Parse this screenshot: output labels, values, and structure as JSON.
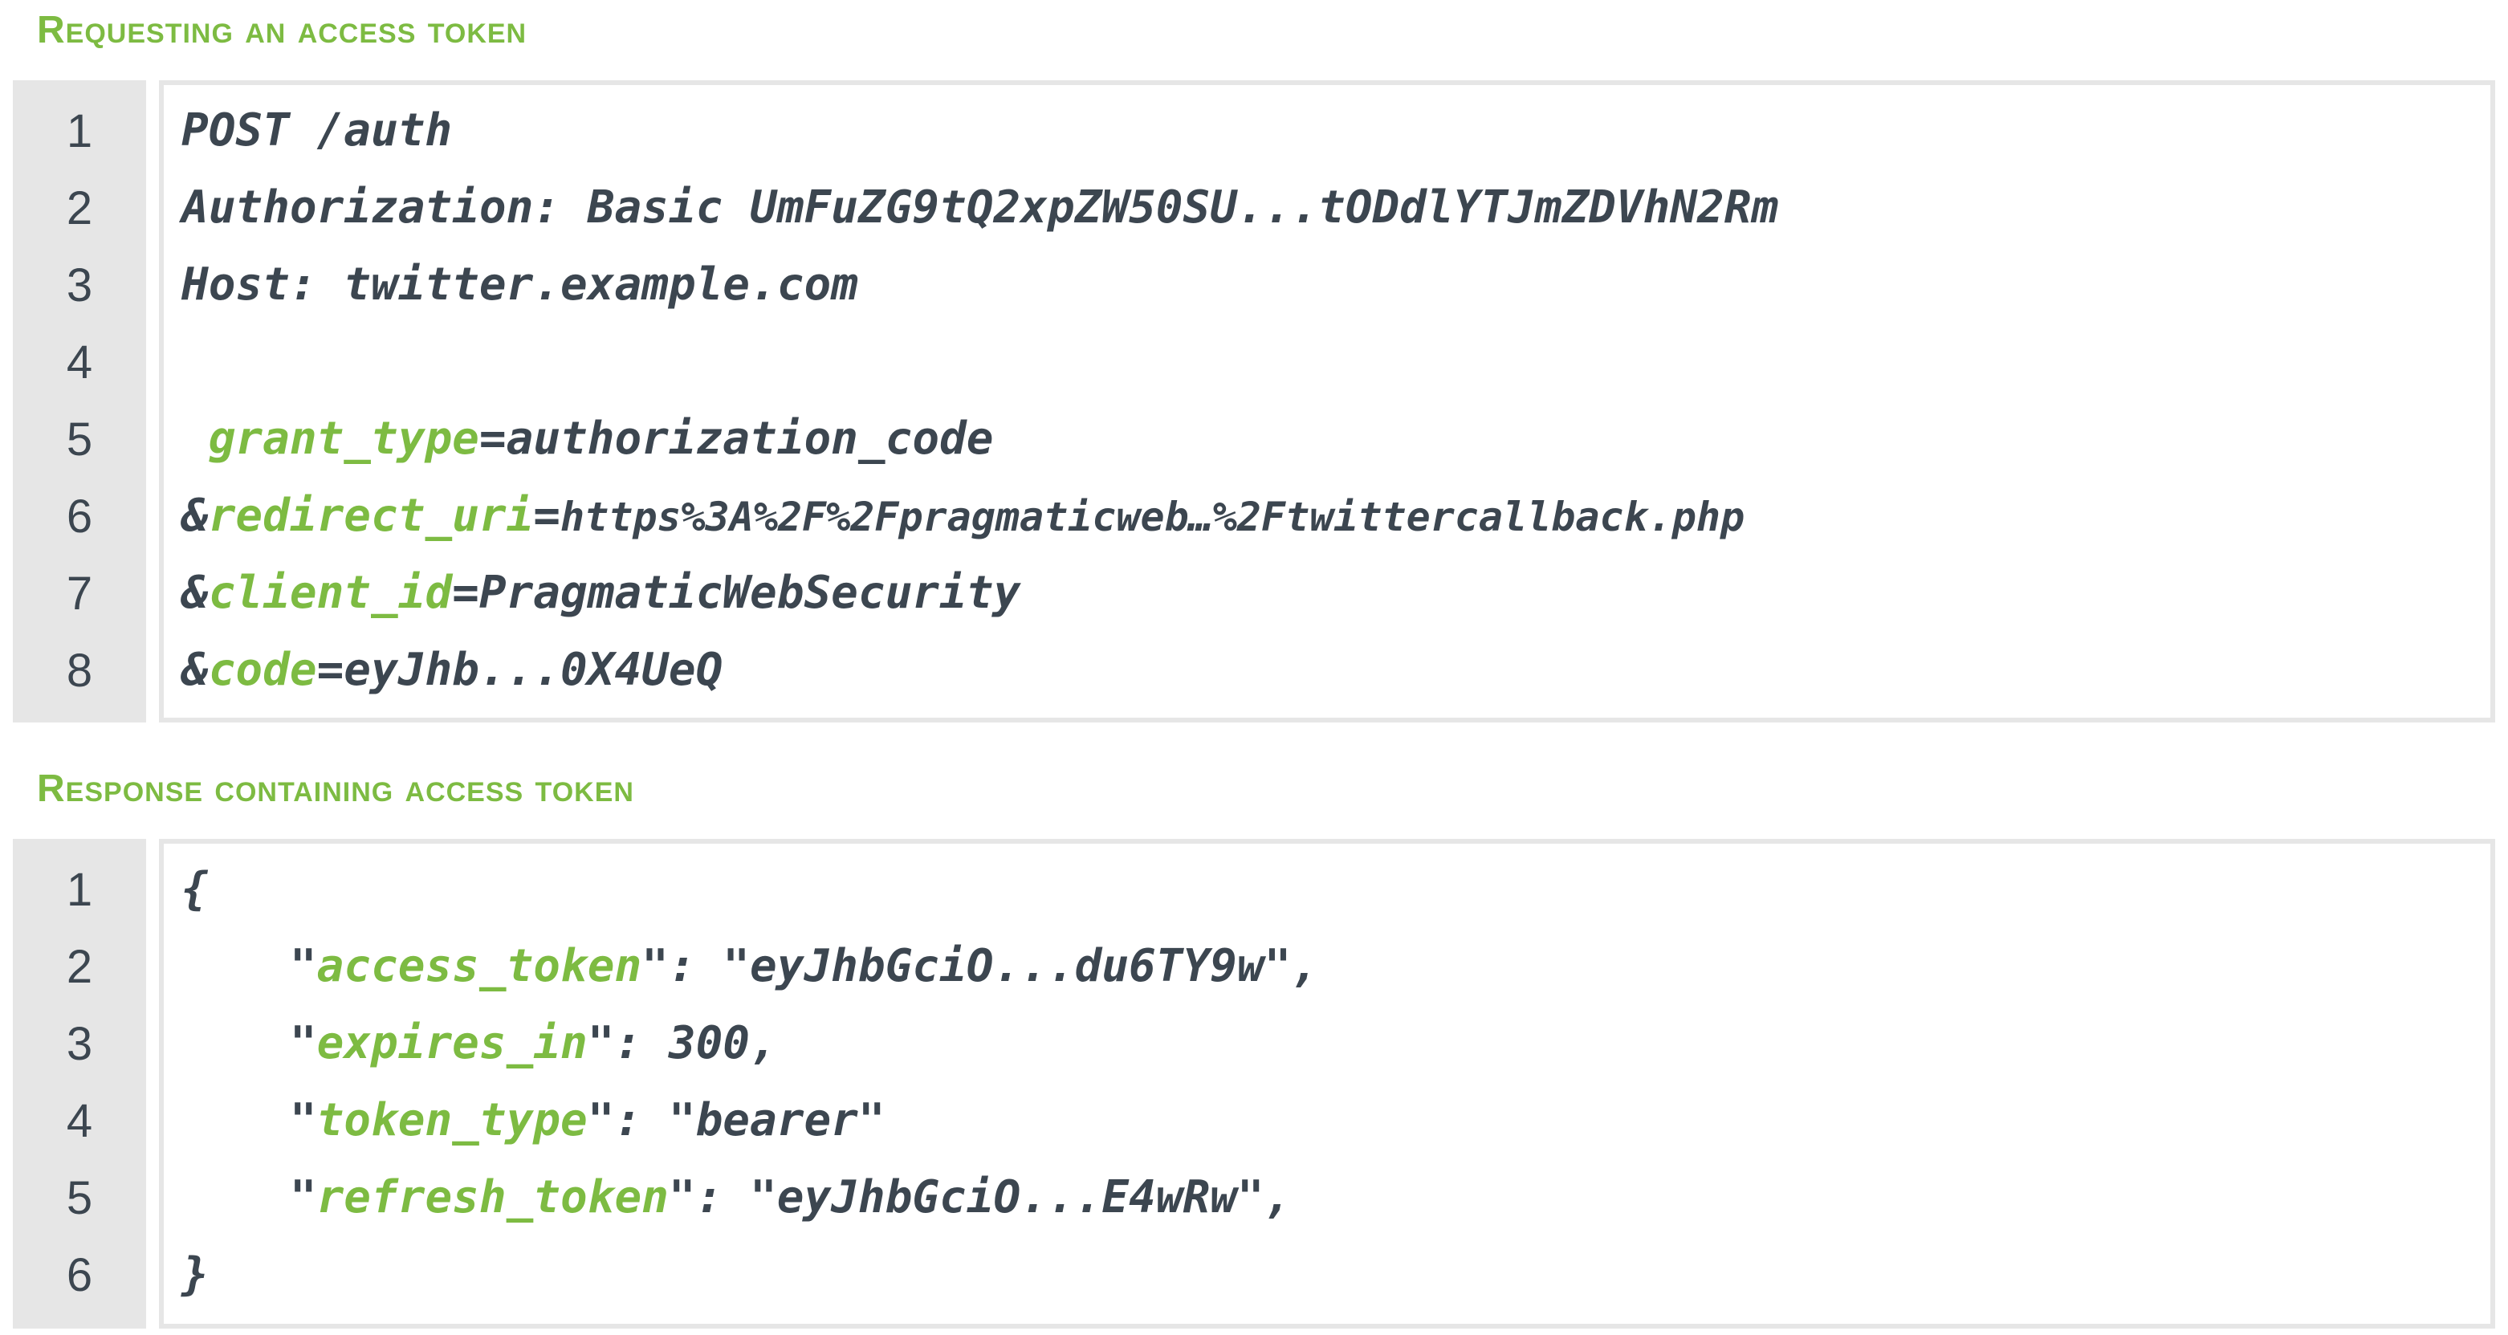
{
  "request": {
    "title": "Requesting an access token",
    "line_numbers": [
      "1",
      "2",
      "3",
      "4",
      "5",
      "6",
      "7",
      "8"
    ],
    "lines": {
      "l1": "POST /auth",
      "l2": "Authorization: Basic UmFuZG9tQ2xpZW50SU...tODdlYTJmZDVhN2Rm",
      "l3": "Host: twitter.example.com",
      "l5_pre": " ",
      "l5_key": "grant_type",
      "l5_val": "=authorization_code",
      "l6_pre": "&",
      "l6_key": "redirect_uri",
      "l6_eq": "=",
      "l6_val": "https%3A%2F%2Fpragmaticweb…%2Ftwittercallback.php",
      "l7_pre": "&",
      "l7_key": "client_id",
      "l7_val": "=PragmaticWebSecurity",
      "l8_pre": "&",
      "l8_key": "code",
      "l8_val": "=eyJhb...0X4UeQ"
    }
  },
  "response": {
    "title": "Response containing access token",
    "line_numbers": [
      "1",
      "2",
      "3",
      "4",
      "5",
      "6"
    ],
    "lines": {
      "l1": "{",
      "l2_indent": "    \"",
      "l2_key": "access_token",
      "l2_val": "\": \"eyJhbGciO...du6TY9w\",",
      "l3_indent": "    \"",
      "l3_key": "expires_in",
      "l3_val": "\": 300,",
      "l4_indent": "    \"",
      "l4_key": "token_type",
      "l4_val": "\": \"bearer\"",
      "l5_indent": "    \"",
      "l5_key": "refresh_token",
      "l5_val": "\": \"eyJhbGciO...E4wRw\",",
      "l6": "}"
    }
  },
  "colors": {
    "accent": "#7dbb42",
    "text": "#3c4650",
    "gutter": "#e6e6e6"
  }
}
